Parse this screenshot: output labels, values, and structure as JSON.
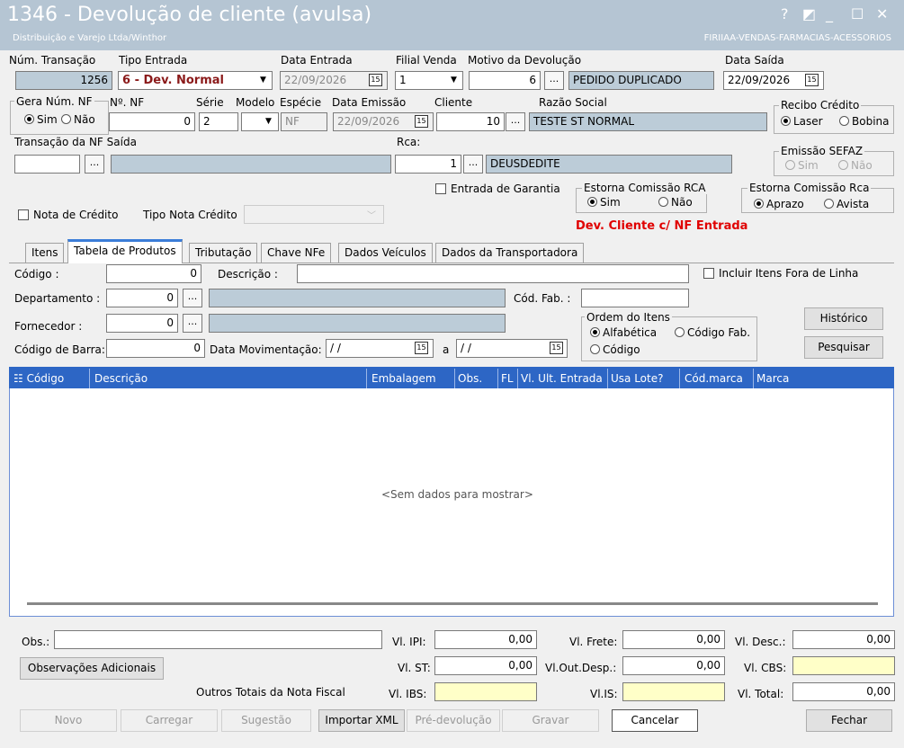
{
  "window": {
    "title": "1346 - Devolução de cliente (avulsa)",
    "subtitle": "Distribuição e Varejo Ltda/Winthor",
    "subtitle_right": "FIRIIAA-VENDAS-FARMACIAS-ACESSORIOS",
    "help": "?",
    "restore": "◩",
    "minimize": "_",
    "maximize": "☐",
    "close": "✕"
  },
  "header": {
    "num_transacao_label": "Núm. Transação",
    "num_transacao": "1256",
    "tipo_entrada_label": "Tipo Entrada",
    "tipo_entrada": "6 - Dev. Normal",
    "data_entrada_label": "Data Entrada",
    "data_entrada": "22/09/2026",
    "filial_venda_label": "Filial Venda",
    "filial_venda": "1",
    "motivo_label": "Motivo da Devolução",
    "motivo_code": "6",
    "motivo_desc": "PEDIDO DUPLICADO",
    "data_saida_label": "Data Saída",
    "data_saida": "22/09/2026",
    "gera_num_nf_label": "Gera Núm. NF",
    "sim": "Sim",
    "nao": "Não",
    "num_nf_label": "Nº. NF",
    "num_nf": "0",
    "serie_label": "Série",
    "serie": "2",
    "modelo_label": "Modelo",
    "modelo": "",
    "especie_label": "Espécie",
    "especie": "NF",
    "data_emissao_label": "Data Emissão",
    "data_emissao": "22/09/2026",
    "cliente_label": "Cliente",
    "cliente": "10",
    "razao_social_label": "Razão Social",
    "razao_social": "TESTE ST NORMAL",
    "recibo_label": "Recibo Crédito",
    "laser": "Laser",
    "bobina": "Bobina",
    "transacao_nf_saida_label": "Transação da NF Saída",
    "transacao_nf_saida": "",
    "rca_label": "Rca:",
    "rca": "1",
    "rca_nome": "DEUSDEDITE",
    "emissao_sefaz_label": "Emissão SEFAZ",
    "entrada_garantia_label": "Entrada de Garantia",
    "estorna_rca_label": "Estorna Comissão RCA",
    "estorna_rca2_label": "Estorna Comissão Rca",
    "aprazo": "Aprazo",
    "avista": "Avista",
    "nota_credito_label": "Nota de Crédito",
    "tipo_nota_credito_label": "Tipo Nota Crédito",
    "tipo_nota_credito": "",
    "status_msg": "Dev. Cliente c/ NF Entrada"
  },
  "tabs": [
    "Itens",
    "Tabela de Produtos",
    "Tributação",
    "Chave NFe",
    "Dados Veículos",
    "Dados da Transportadora"
  ],
  "filters": {
    "codigo_label": "Código :",
    "codigo": "0",
    "descricao_label": "Descrição :",
    "descricao": "",
    "incluir_label": "Incluir Itens Fora de Linha",
    "departamento_label": "Departamento :",
    "departamento": "0",
    "departamento_desc": "",
    "cod_fab_label": "Cód. Fab. :",
    "cod_fab": "",
    "fornecedor_label": "Fornecedor :",
    "fornecedor": "0",
    "fornecedor_desc": "",
    "ordem_label": "Ordem do Itens",
    "alfabetica": "Alfabética",
    "codigo_fab": "Código Fab.",
    "codigo_opt": "Código",
    "historico_btn": "Histórico",
    "pesquisar_btn": "Pesquisar",
    "codigo_barra_label": "Código de Barra:",
    "codigo_barra": "0",
    "data_mov_label": "Data Movimentação:",
    "data_ini": "/ /",
    "a_label": "a",
    "data_fim": "/ /"
  },
  "grid": {
    "columns": [
      "Código",
      "Descrição",
      "Embalagem",
      "Obs.",
      "FL",
      "Vl. Ult. Entrada",
      "Usa Lote?",
      "Cód.marca",
      "Marca"
    ],
    "empty": "<Sem dados para mostrar>"
  },
  "totals": {
    "obs_label": "Obs.:",
    "obs": "",
    "obs_adic_btn": "Observações Adicionais",
    "outros_totais_label": "Outros Totais da Nota Fiscal",
    "vl_ipi_label": "Vl. IPI:",
    "vl_ipi": "0,00",
    "vl_st_label": "Vl. ST:",
    "vl_st": "0,00",
    "vl_ibs_label": "Vl. IBS:",
    "vl_ibs": "",
    "vl_frete_label": "Vl. Frete:",
    "vl_frete": "0,00",
    "vl_outdesp_label": "Vl.Out.Desp.:",
    "vl_outdesp": "0,00",
    "vl_is_label": "Vl.IS:",
    "vl_is": "",
    "vl_desc_label": "Vl. Desc.:",
    "vl_desc": "0,00",
    "vl_cbs_label": "Vl. CBS:",
    "vl_cbs": "",
    "vl_total_label": "Vl. Total:",
    "vl_total": "0,00"
  },
  "footer": {
    "novo": "Novo",
    "carregar": "Carregar",
    "sugestao": "Sugestão",
    "importar_xml": "Importar XML",
    "pre_devolucao": "Pré-devolução",
    "gravar": "Gravar",
    "cancelar": "Cancelar",
    "fechar": "Fechar"
  },
  "colors": {
    "titlebar": "#b5c5d3",
    "grid_header": "#2d66c5",
    "status": "#e00000",
    "tab_active": "#3b7dd8"
  }
}
